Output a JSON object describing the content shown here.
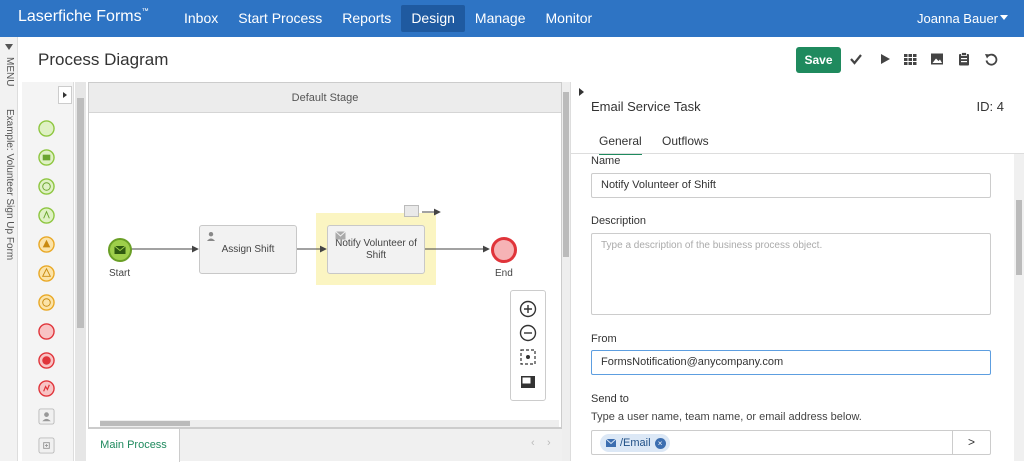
{
  "topbar": {
    "brand": "Laserfiche Forms",
    "brand_mark": "™",
    "nav": [
      {
        "label": "Inbox"
      },
      {
        "label": "Start Process"
      },
      {
        "label": "Reports"
      },
      {
        "label": "Design",
        "active": true
      },
      {
        "label": "Manage"
      },
      {
        "label": "Monitor"
      }
    ],
    "user": "Joanna Bauer"
  },
  "side_rail": {
    "menu_label": "MENU",
    "form_label": "Example: Volunteer Sign Up Form"
  },
  "page": {
    "title": "Process Diagram",
    "save_label": "Save"
  },
  "diagram": {
    "stage_label": "Default Stage",
    "start_label": "Start",
    "end_label": "End",
    "task1_label": "Assign Shift",
    "task2_label": "Notify Volunteer of Shift",
    "main_tab_label": "Main Process",
    "prev_arrow": "‹",
    "next_arrow": "›"
  },
  "properties": {
    "title": "Email Service Task",
    "id_text": "ID: 4",
    "tabs": [
      {
        "label": "General",
        "active": true
      },
      {
        "label": "Outflows"
      }
    ],
    "name_label": "Name",
    "name_value": "Notify Volunteer of Shift",
    "description_label": "Description",
    "description_placeholder": "Type a description of the business process object.",
    "from_label": "From",
    "from_value": "FormsNotification@anycompany.com",
    "send_to_label": "Send to",
    "send_to_hint": "Type a user name, team name, or email address below.",
    "send_to_tag": "/Email",
    "send_to_arrow": ">"
  },
  "colors": {
    "topbar": "#2e74c4",
    "save": "#1f8a5e",
    "start_event": "#8dc63f",
    "end_event": "#e0343a"
  }
}
